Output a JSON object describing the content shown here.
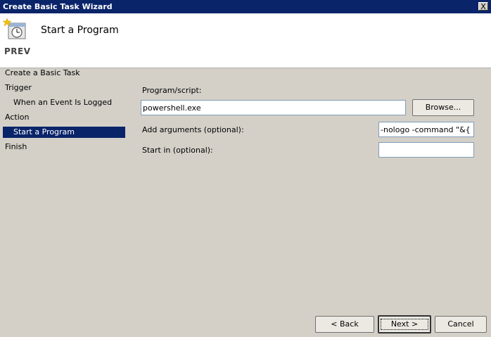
{
  "window": {
    "title": "Create Basic Task Wizard",
    "close_label": "X"
  },
  "header": {
    "icon_name": "task-clock-icon",
    "title": "Start a Program",
    "watermark": "PREV"
  },
  "sidebar": {
    "items": [
      {
        "label": "Create a Basic Task",
        "selected": false
      },
      {
        "label": "Trigger",
        "selected": false
      },
      {
        "label": "When an Event Is Logged",
        "selected": false
      },
      {
        "label": "Action",
        "selected": false
      },
      {
        "label": "Start a Program",
        "selected": true
      },
      {
        "label": "Finish",
        "selected": false
      }
    ]
  },
  "form": {
    "program": {
      "label": "Program/script:",
      "value": "powershell.exe"
    },
    "browse_label": "Browse...",
    "arguments": {
      "label": "Add arguments (optional):",
      "value": "-nologo -command \"&{"
    },
    "start_in": {
      "label": "Start in (optional):",
      "value": ""
    }
  },
  "footer": {
    "back_label": "< Back",
    "next_label": "Next >",
    "cancel_label": "Cancel"
  },
  "colors": {
    "title_bar": "#0a246a",
    "selection": "#0a246a",
    "dialog_bg": "#d4d0c8"
  }
}
